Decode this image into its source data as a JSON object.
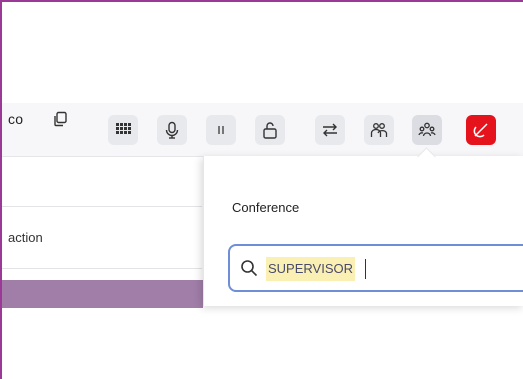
{
  "caller": {
    "name_partial": "co"
  },
  "toolbar": {
    "buttons": [
      {
        "icon": "dialpad-icon"
      },
      {
        "icon": "microphone-icon"
      },
      {
        "icon": "pause-icon"
      },
      {
        "icon": "unlock-icon"
      },
      {
        "icon": "transfer-icon"
      },
      {
        "icon": "consult-icon"
      },
      {
        "icon": "conference-icon"
      },
      {
        "icon": "hangup-icon"
      }
    ],
    "hangup_color": "#e5141c"
  },
  "list": {
    "row_label_partial": "action"
  },
  "conference_popup": {
    "title": "Conference",
    "search": {
      "value": "SUPERVISOR"
    }
  },
  "colors": {
    "frame": "#9b3a96",
    "accent_bar": "#a07ea8",
    "search_border": "#6e8fd8",
    "highlight": "#fbf0b4"
  }
}
